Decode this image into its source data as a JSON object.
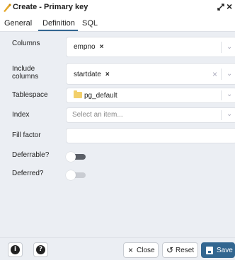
{
  "dialog": {
    "title": "Create - Primary key"
  },
  "tabs": [
    {
      "label": "General"
    },
    {
      "label": "Definition"
    },
    {
      "label": "SQL"
    }
  ],
  "active_tab": "Definition",
  "form": {
    "columns": {
      "label": "Columns",
      "chips": [
        "empno"
      ]
    },
    "include_columns": {
      "label": "Include columns",
      "chips": [
        "startdate"
      ]
    },
    "tablespace": {
      "label": "Tablespace",
      "value": "pg_default"
    },
    "index": {
      "label": "Index",
      "placeholder": "Select an item..."
    },
    "fill_factor": {
      "label": "Fill factor",
      "value": ""
    },
    "deferrable": {
      "label": "Deferrable?",
      "value": false
    },
    "deferred": {
      "label": "Deferred?",
      "value": false
    }
  },
  "footer": {
    "info_label": "i",
    "help_label": "?",
    "close_label": "Close",
    "reset_label": "Reset",
    "save_label": "Save"
  },
  "colors": {
    "accent": "#326690",
    "background": "#ebeef3",
    "folder": "#f2cf6a"
  },
  "icons": {
    "title": "constraint-key-icon",
    "expand": "expand-icon",
    "close": "close-icon",
    "folder": "folder-icon",
    "info": "info-icon",
    "help": "help-icon",
    "save": "save-icon",
    "reset": "reset-icon"
  }
}
